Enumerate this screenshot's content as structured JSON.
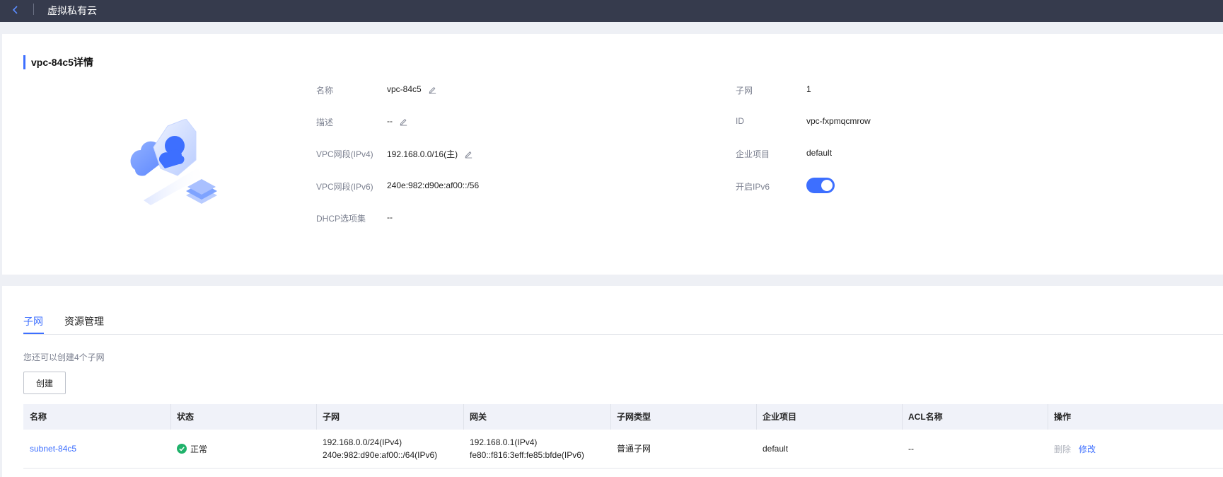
{
  "header": {
    "title": "虚拟私有云"
  },
  "detail": {
    "section_title": "vpc-84c5详情",
    "left_fields": [
      {
        "label": "名称",
        "value": "vpc-84c5",
        "editable": true
      },
      {
        "label": "描述",
        "value": "--",
        "editable": true
      },
      {
        "label": "VPC网段(IPv4)",
        "value": "192.168.0.0/16(主)",
        "editable": true
      },
      {
        "label": "VPC网段(IPv6)",
        "value": "240e:982:d90e:af00::/56",
        "editable": false
      },
      {
        "label": "DHCP选项集",
        "value": "--",
        "editable": false
      }
    ],
    "right_fields": [
      {
        "label": "子网",
        "value": "1"
      },
      {
        "label": "ID",
        "value": "vpc-fxpmqcmrow"
      },
      {
        "label": "企业项目",
        "value": "default"
      },
      {
        "label": "开启IPv6",
        "toggle_on": true
      }
    ]
  },
  "tabs": [
    {
      "label": "子网",
      "active": true
    },
    {
      "label": "资源管理",
      "active": false
    }
  ],
  "subnets": {
    "hint": "您还可以创建4个子网",
    "create_label": "创建",
    "columns": [
      "名称",
      "状态",
      "子网",
      "网关",
      "子网类型",
      "企业项目",
      "ACL名称",
      "操作"
    ],
    "rows": [
      {
        "name": "subnet-84c5",
        "status": "正常",
        "subnet_ipv4": "192.168.0.0/24(IPv4)",
        "subnet_ipv6": "240e:982:d90e:af00::/64(IPv6)",
        "gateway_ipv4": "192.168.0.1(IPv4)",
        "gateway_ipv6": "fe80::f816:3eff:fe85:bfde(IPv6)",
        "type": "普通子网",
        "enterprise": "default",
        "acl": "--",
        "actions": [
          "删除",
          "修改"
        ]
      }
    ]
  },
  "colors": {
    "accent": "#3d6fff",
    "topbar": "#363b4d",
    "status_ok": "#20b26b"
  }
}
